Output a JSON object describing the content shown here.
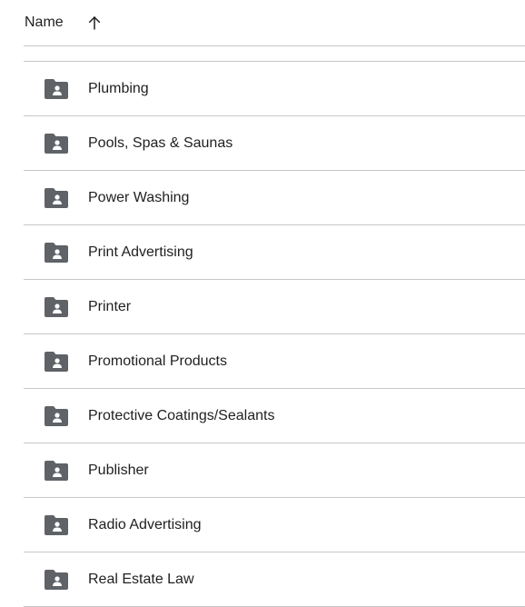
{
  "header": {
    "name_label": "Name",
    "sort_icon": "arrow-up-icon"
  },
  "colors": {
    "icon": "#5f6368",
    "divider": "#c7c7c7",
    "text": "#1f1f1f"
  },
  "folders": [
    {
      "label": "Plumbing",
      "icon": "shared-folder-icon"
    },
    {
      "label": "Pools, Spas & Saunas",
      "icon": "shared-folder-icon"
    },
    {
      "label": "Power Washing",
      "icon": "shared-folder-icon"
    },
    {
      "label": "Print Advertising",
      "icon": "shared-folder-icon"
    },
    {
      "label": "Printer",
      "icon": "shared-folder-icon"
    },
    {
      "label": "Promotional Products",
      "icon": "shared-folder-icon"
    },
    {
      "label": "Protective Coatings/Sealants",
      "icon": "shared-folder-icon"
    },
    {
      "label": "Publisher",
      "icon": "shared-folder-icon"
    },
    {
      "label": "Radio Advertising",
      "icon": "shared-folder-icon"
    },
    {
      "label": "Real Estate Law",
      "icon": "shared-folder-icon"
    }
  ]
}
